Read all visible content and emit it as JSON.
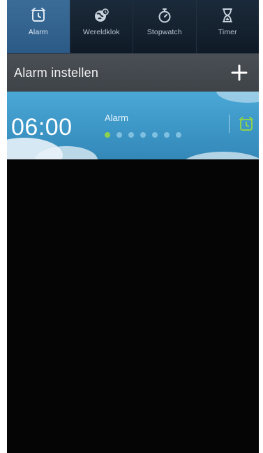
{
  "tabs": [
    {
      "label": "Alarm",
      "icon": "alarm-clock-icon",
      "active": true
    },
    {
      "label": "Wereldklok",
      "icon": "globe-icon",
      "active": false
    },
    {
      "label": "Stopwatch",
      "icon": "stopwatch-icon",
      "active": false
    },
    {
      "label": "Timer",
      "icon": "hourglass-icon",
      "active": false
    }
  ],
  "header": {
    "title": "Alarm instellen",
    "add_icon": "plus-icon"
  },
  "alarm": {
    "time": "06:00",
    "label": "Alarm",
    "days_active": [
      true,
      false,
      false,
      false,
      false,
      false,
      false
    ],
    "toggle_icon": "alarm-clock-icon",
    "enabled": true
  },
  "colors": {
    "active_tab": "#3b6c98",
    "alarm_card": "#3c96c6",
    "toggle_on": "#8fd14f"
  }
}
